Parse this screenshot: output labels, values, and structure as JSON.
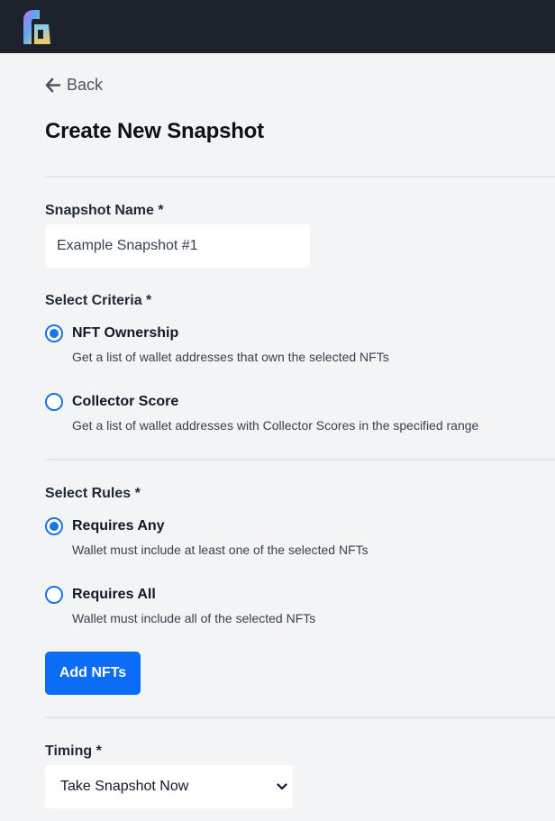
{
  "header": {
    "logo_icon": "app-logo"
  },
  "nav": {
    "back_label": "Back"
  },
  "page": {
    "title": "Create New Snapshot"
  },
  "form": {
    "snapshot_name": {
      "label": "Snapshot Name *",
      "value": "Example Snapshot #1"
    },
    "criteria": {
      "label": "Select Criteria *",
      "options": [
        {
          "title": "NFT Ownership",
          "description": "Get a list of wallet addresses that own the selected NFTs",
          "checked": true
        },
        {
          "title": "Collector Score",
          "description": "Get a list of wallet addresses with Collector Scores in the specified range",
          "checked": false
        }
      ]
    },
    "rules": {
      "label": "Select Rules *",
      "options": [
        {
          "title": "Requires Any",
          "description": "Wallet must include at least one of the selected NFTs",
          "checked": true
        },
        {
          "title": "Requires All",
          "description": "Wallet must include all of the selected NFTs",
          "checked": false
        }
      ]
    },
    "add_nfts_label": "Add NFTs",
    "timing": {
      "label": "Timing *",
      "selected": "Take Snapshot Now"
    }
  },
  "colors": {
    "topbar": "#1d212c",
    "accent": "#0b6cf6",
    "background": "#f3f4f6"
  }
}
